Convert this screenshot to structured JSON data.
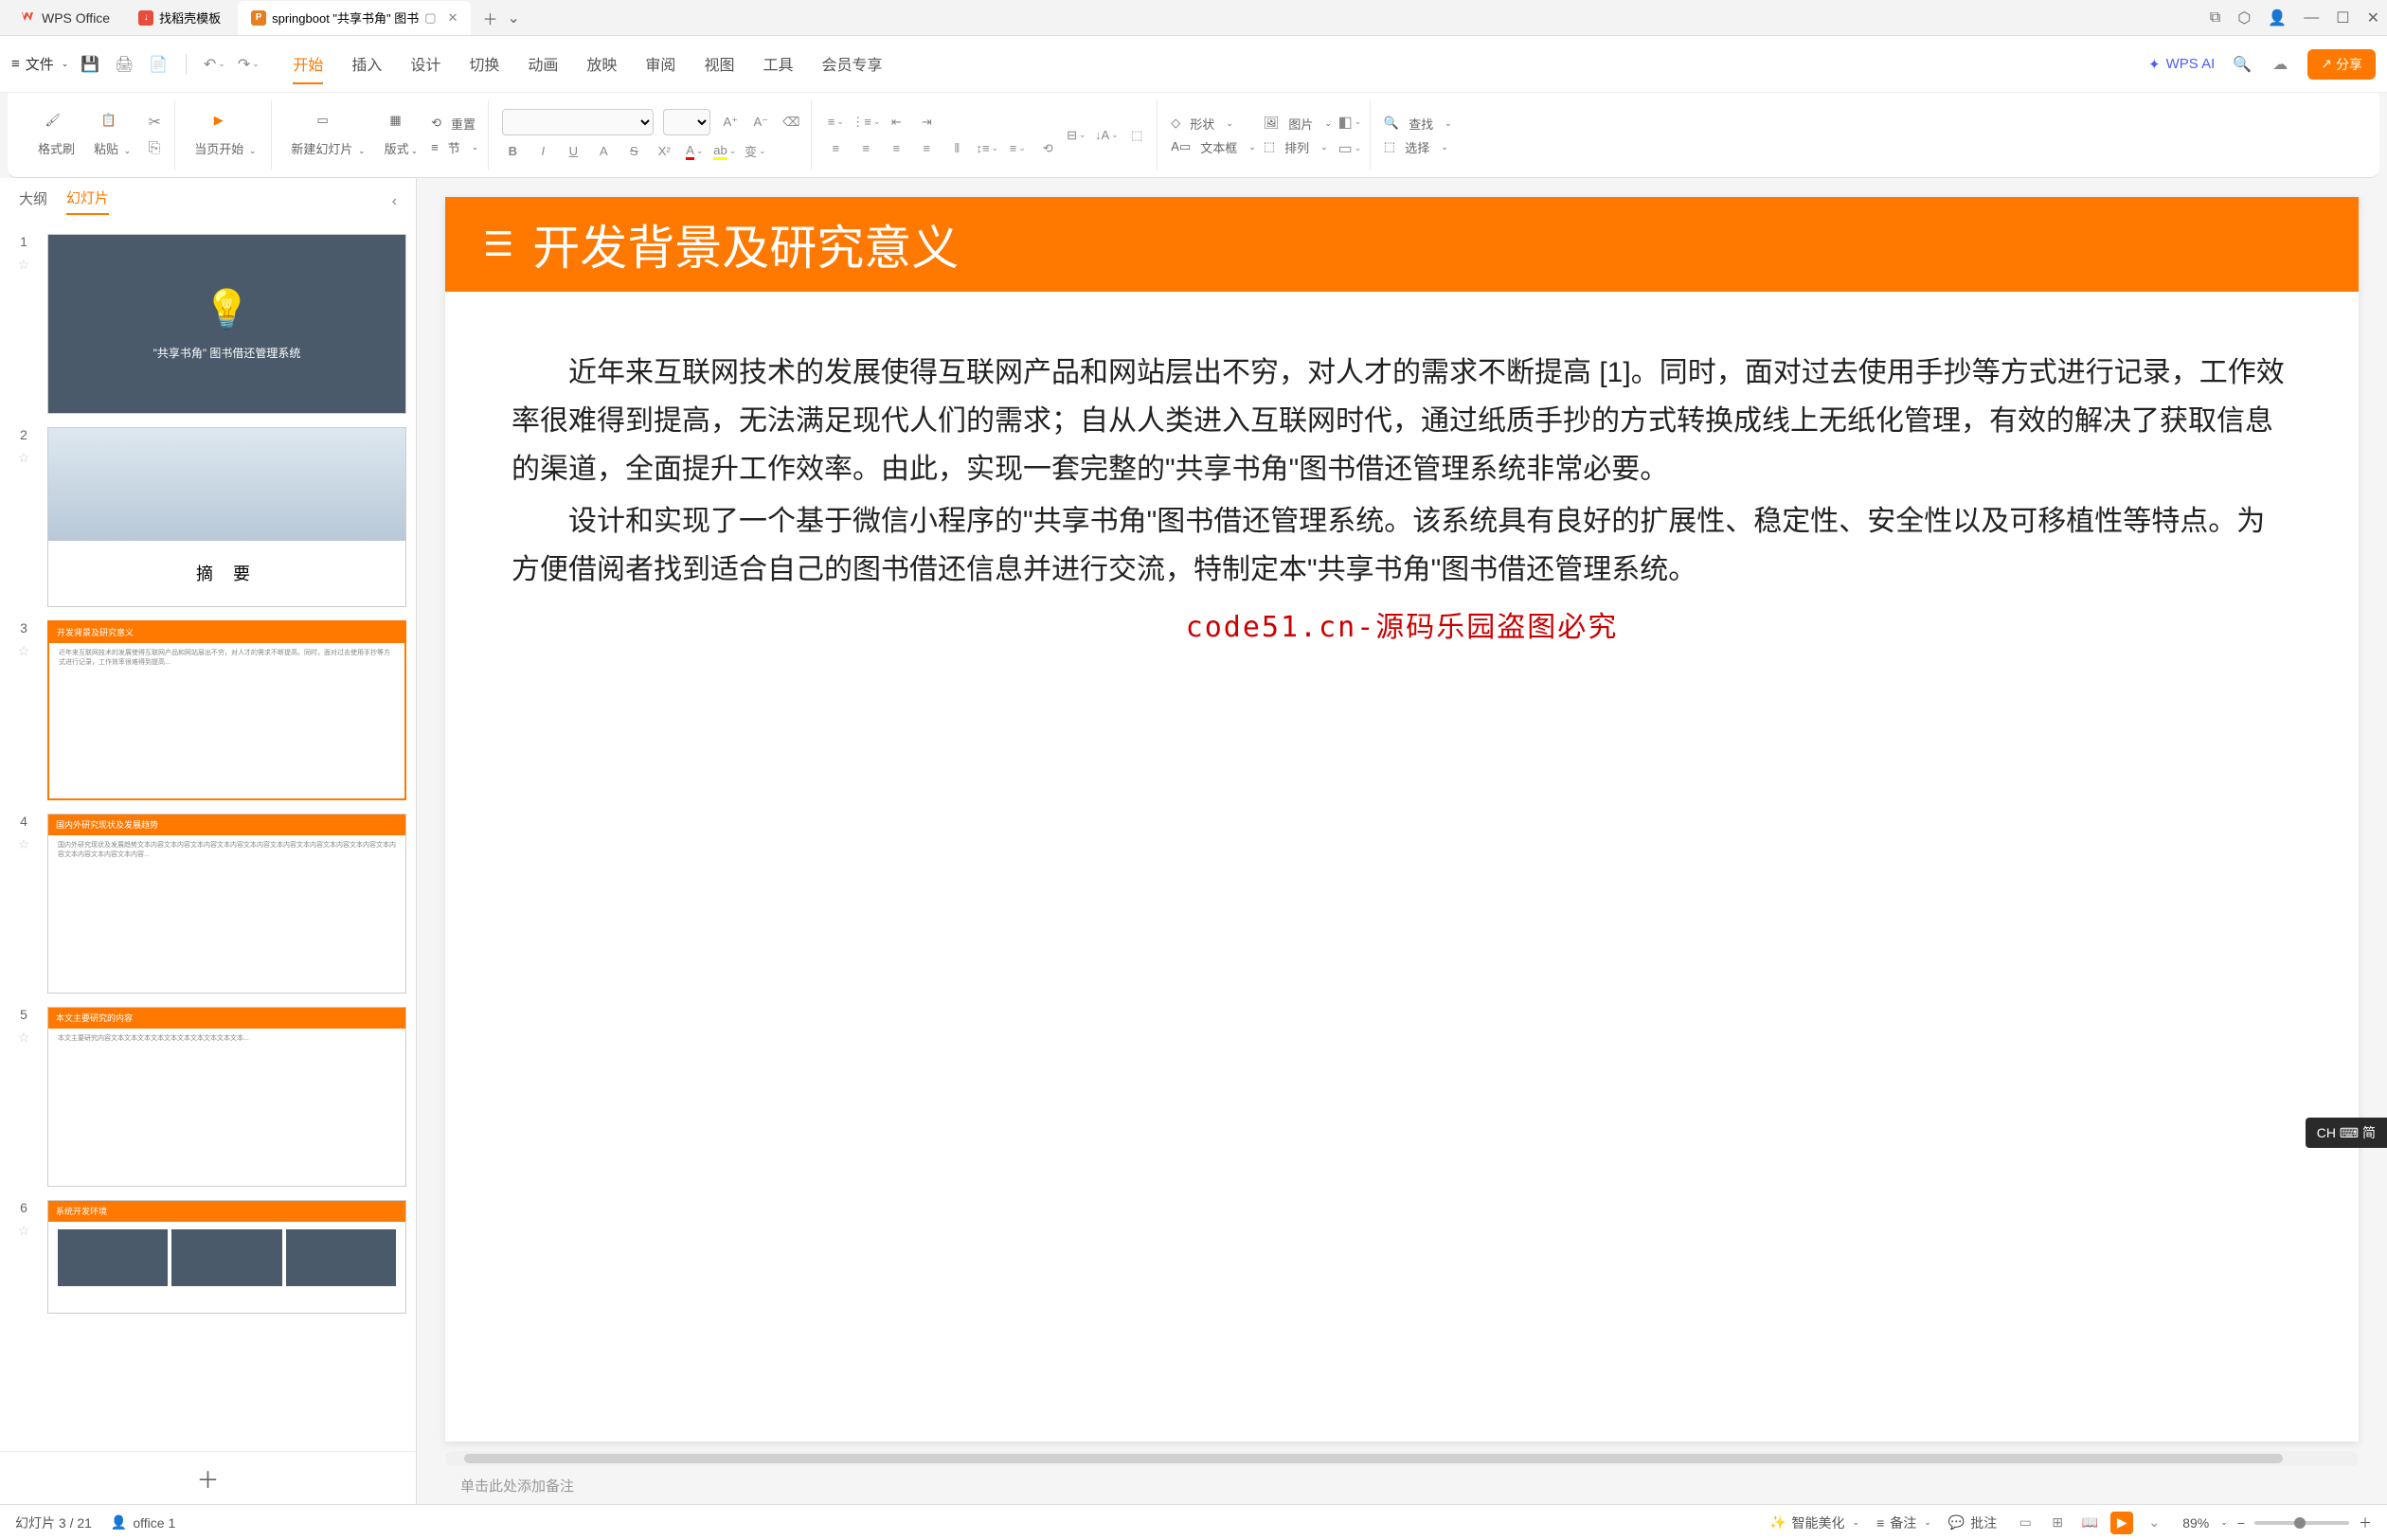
{
  "app": {
    "name": "WPS Office"
  },
  "tabs": [
    {
      "label": "找稻壳模板",
      "iconColor": "red",
      "active": false
    },
    {
      "label": "springboot \"共享书角\" 图书",
      "iconColor": "orange",
      "iconText": "P",
      "active": true
    }
  ],
  "file_menu": "文件",
  "menu_tabs": [
    "开始",
    "插入",
    "设计",
    "切换",
    "动画",
    "放映",
    "审阅",
    "视图",
    "工具",
    "会员专享"
  ],
  "menu_active": "开始",
  "wps_ai": "WPS AI",
  "share": "分享",
  "ribbon": {
    "format_painter": "格式刷",
    "paste": "粘贴",
    "from_current": "当页开始",
    "new_slide": "新建幻灯片",
    "layout": "版式",
    "section": "节",
    "reset": "重置",
    "shape": "形状",
    "textbox": "文本框",
    "picture": "图片",
    "arrange": "排列",
    "find": "查找",
    "select": "选择"
  },
  "panel": {
    "outline": "大纲",
    "slides": "幻灯片"
  },
  "slides": [
    {
      "num": 1,
      "title": "\"共享书角\" 图书借还管理系统"
    },
    {
      "num": 2,
      "label": "摘  要"
    },
    {
      "num": 3,
      "bar": "开发背景及研究意义"
    },
    {
      "num": 4,
      "bar": "国内外研究现状及发展趋势"
    },
    {
      "num": 5,
      "bar": "本文主要研究的内容"
    },
    {
      "num": 6,
      "bar": "系统开发环境"
    }
  ],
  "current_slide": {
    "title": "开发背景及研究意义",
    "p1": "近年来互联网技术的发展使得互联网产品和网站层出不穷，对人才的需求不断提高 [1]。同时，面对过去使用手抄等方式进行记录，工作效率很难得到提高，无法满足现代人们的需求；自从人类进入互联网时代，通过纸质手抄的方式转换成线上无纸化管理，有效的解决了获取信息的渠道，全面提升工作效率。由此，实现一套完整的\"共享书角\"图书借还管理系统非常必要。",
    "p2": "设计和实现了一个基于微信小程序的\"共享书角\"图书借还管理系统。该系统具有良好的扩展性、稳定性、安全性以及可移植性等特点。为方便借阅者找到适合自己的图书借还信息并进行交流，特制定本\"共享书角\"图书借还管理系统。",
    "watermark": "code51.cn-源码乐园盗图必究"
  },
  "notes_placeholder": "单击此处添加备注",
  "ime": "CH ⌨ 简",
  "status": {
    "slide_count": "幻灯片 3 / 21",
    "office": "office 1",
    "beautify": "智能美化",
    "notes": "备注",
    "comments": "批注",
    "zoom": "89%"
  }
}
